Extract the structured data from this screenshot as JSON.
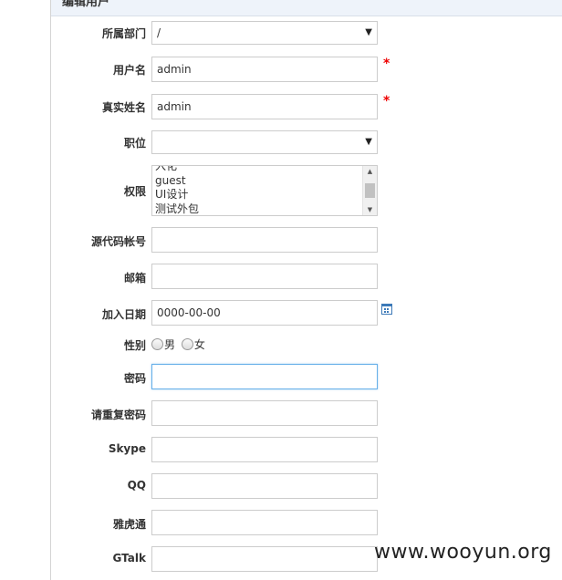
{
  "header": {
    "title": "编辑用户"
  },
  "form": {
    "department": {
      "label": "所属部门",
      "value": "/"
    },
    "username": {
      "label": "用户名",
      "value": "admin",
      "required_mark": "*"
    },
    "realname": {
      "label": "真实姓名",
      "value": "admin",
      "required_mark": "*"
    },
    "position": {
      "label": "职位",
      "value": ""
    },
    "permission": {
      "label": "权限",
      "options": [
        "入化",
        "guest",
        "UI设计",
        "测试外包"
      ]
    },
    "source_account": {
      "label": "源代码帐号",
      "value": ""
    },
    "email": {
      "label": "邮箱",
      "value": ""
    },
    "join_date": {
      "label": "加入日期",
      "value": "0000-00-00"
    },
    "gender": {
      "label": "性别",
      "options": [
        "男",
        "女"
      ]
    },
    "password": {
      "label": "密码",
      "value": ""
    },
    "password_repeat": {
      "label": "请重复密码",
      "value": ""
    },
    "skype": {
      "label": "Skype",
      "value": ""
    },
    "qq": {
      "label": "QQ",
      "value": ""
    },
    "yahoo": {
      "label": "雅虎通",
      "value": ""
    },
    "gtalk": {
      "label": "GTalk",
      "value": ""
    }
  },
  "icons": {
    "select_arrow": "▼",
    "scroll_up": "▲",
    "scroll_down": "▼",
    "calendar": "calendar-icon"
  },
  "watermark": "www.wooyun.org"
}
